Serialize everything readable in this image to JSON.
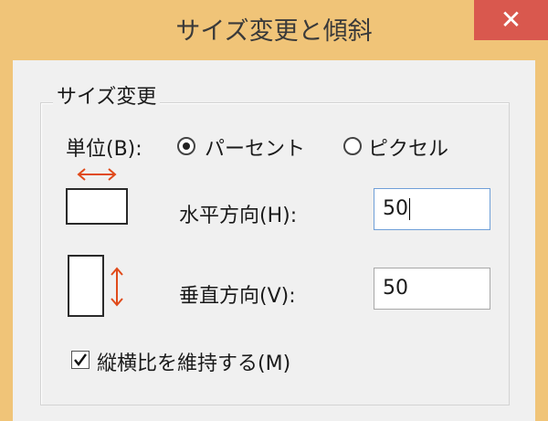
{
  "window": {
    "title": "サイズ変更と傾斜",
    "close_glyph": "✕"
  },
  "resize_group": {
    "label": "サイズ変更",
    "unit_label": "単位(B):",
    "unit_options": [
      {
        "label": "パーセント",
        "selected": true
      },
      {
        "label": "ピクセル",
        "selected": false
      }
    ],
    "horizontal_label": "水平方向(H):",
    "horizontal_value": "50",
    "vertical_label": "垂直方向(V):",
    "vertical_value": "50",
    "keep_aspect_label": "縦横比を維持する(M)",
    "keep_aspect_checked": true
  },
  "icons": {
    "horizontal_arrow": "double-headed-horizontal-arrow-icon",
    "vertical_arrow": "double-headed-vertical-arrow-icon"
  },
  "colors": {
    "titlebar": "#f0c478",
    "close": "#d9584e",
    "arrow": "#e04a1a",
    "focus": "#6f9fd8"
  }
}
